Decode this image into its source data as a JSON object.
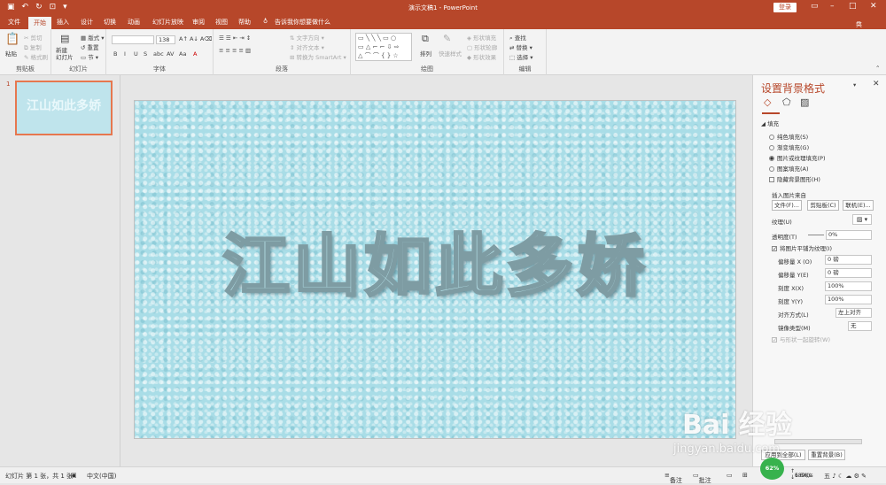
{
  "titlebar": {
    "title": "演示文稿1  -  PowerPoint",
    "login": "登录",
    "share": "共享"
  },
  "tabs": [
    "文件",
    "开始",
    "插入",
    "设计",
    "切换",
    "动画",
    "幻灯片放映",
    "审阅",
    "视图",
    "帮助"
  ],
  "tellme": "告诉我你想要做什么",
  "clipboard": {
    "paste": "粘贴",
    "cut": "剪切",
    "copy": "复制",
    "format_painter": "格式刷",
    "label": "剪贴板"
  },
  "slides_grp": {
    "new_slide": "新建\n幻灯片",
    "layout": "版式",
    "reset": "重置",
    "section": "节",
    "label": "幻灯片"
  },
  "font": {
    "size": "138",
    "label": "字体",
    "tools": [
      "B",
      "I",
      "U",
      "S",
      "abc",
      "AV",
      "Aa",
      "A"
    ]
  },
  "paragraph": {
    "text_direction": "文字方向",
    "align_text": "对齐文本",
    "smartart": "转换为 SmartArt",
    "label": "段落"
  },
  "drawing": {
    "arrange": "排列",
    "quick_styles": "快速样式",
    "shape_fill": "形状填充",
    "shape_outline": "形状轮廓",
    "shape_effects": "形状效果",
    "label": "绘图"
  },
  "editing": {
    "find": "查找",
    "replace": "替换",
    "select": "选择",
    "label": "编辑"
  },
  "slide": {
    "number": "1",
    "thumb_text": "江山如此多娇",
    "text": "江山如此多娇"
  },
  "pane": {
    "title": "设置背景格式",
    "section": "填充",
    "options": [
      "纯色填充(S)",
      "渐变填充(G)",
      "图片或纹理填充(P)",
      "图案填充(A)"
    ],
    "hide_bg": "隐藏背景图形(H)",
    "insert_from": "插入图片来自",
    "btn_file": "文件(F)...",
    "btn_clip": "剪贴板(C)",
    "btn_online": "联机(E)...",
    "texture": "纹理(U)",
    "transparency": "透明度(T)",
    "transparency_val": "0%",
    "tile": "将图片平铺为纹理(I)",
    "offset_x": "偏移量 X (O)",
    "offset_x_val": "0 磅",
    "offset_y": "偏移量 Y(E)",
    "offset_y_val": "0 磅",
    "scale_x": "刻度 X(X)",
    "scale_x_val": "100%",
    "scale_y": "刻度 Y(Y)",
    "scale_y_val": "100%",
    "alignment": "对齐方式(L)",
    "alignment_val": "左上对齐",
    "mirror": "镜像类型(M)",
    "mirror_val": "无",
    "rotate": "与形状一起旋转(W)",
    "apply_all": "应用到全部(L)",
    "reset_bg": "重置背景(B)"
  },
  "status": {
    "slide": "幻灯片 第 1 张，共 1 张",
    "lang": "中文(中国)",
    "notes": "备注",
    "comments": "批注",
    "net_pct": "62%",
    "up": "189K/s",
    "down": "6.6K/s"
  },
  "watermark": {
    "brand": "Bai 经验",
    "url": "jingyan.baidu.com"
  },
  "colors": {
    "accent": "#b7472a",
    "slide_bg": "#a9dde7"
  }
}
